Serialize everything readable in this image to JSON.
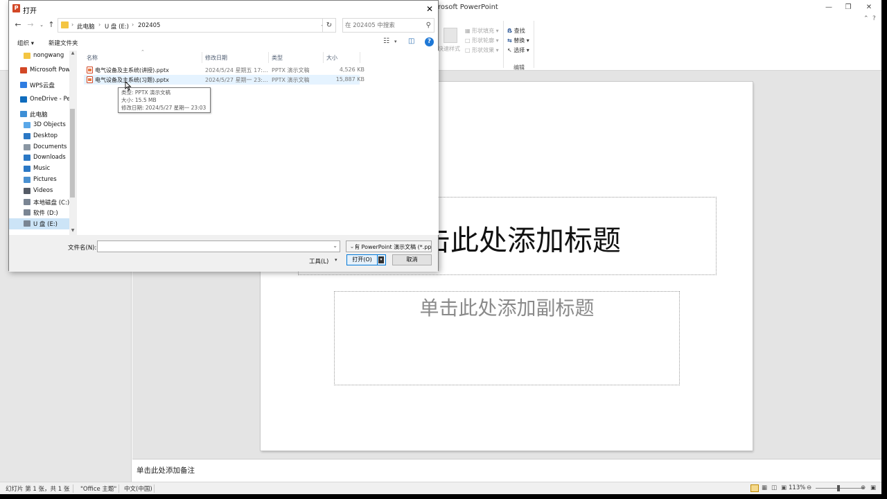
{
  "ppt": {
    "window_title": "rosoft PowerPoint",
    "ribbon": {
      "quick_styles": "快速样式",
      "shape_fill": "形状填充",
      "shape_outline": "形状轮廓",
      "shape_effects": "形状效果",
      "find": "查找",
      "replace": "替换",
      "select": "选择",
      "edit_group": "编辑"
    },
    "slide": {
      "title_placeholder": "单击此处添加标题",
      "subtitle_placeholder": "单击此处添加副标题"
    },
    "notes_placeholder": "单击此处添加备注",
    "status": {
      "slide_info": "幻灯片 第 1 张，共 1 张",
      "theme": "\"Office 主题\"",
      "language": "中文(中国)",
      "zoom": "113%"
    }
  },
  "dialog": {
    "title": "打开",
    "app_icon_letter": "P",
    "breadcrumb": [
      "此电脑",
      "U 盘 (E:)",
      "202405"
    ],
    "search_placeholder": "在 202405 中搜索",
    "toolbar": {
      "organize": "组织 ▾",
      "new_folder": "新建文件夹"
    },
    "nav_items": [
      {
        "label": "nongwang",
        "icon": "folder-icon",
        "color": "#f4c542",
        "indent": 1
      },
      {
        "label": "Microsoft Powe",
        "icon": "powerpoint-icon",
        "color": "#d24726",
        "indent": 0
      },
      {
        "label": "WPS云盘",
        "icon": "cloud-icon",
        "color": "#2f7de1",
        "indent": 0
      },
      {
        "label": "OneDrive - Per",
        "icon": "onedrive-icon",
        "color": "#0f6cbd",
        "indent": 0
      },
      {
        "label": "此电脑",
        "icon": "computer-icon",
        "color": "#3d8fd6",
        "indent": 0
      },
      {
        "label": "3D Objects",
        "icon": "3d-objects-icon",
        "color": "#5aa7e8",
        "indent": 1
      },
      {
        "label": "Desktop",
        "icon": "desktop-icon",
        "color": "#2b78c5",
        "indent": 1
      },
      {
        "label": "Documents",
        "icon": "documents-icon",
        "color": "#8a96a3",
        "indent": 1
      },
      {
        "label": "Downloads",
        "icon": "downloads-icon",
        "color": "#2b78c5",
        "indent": 1
      },
      {
        "label": "Music",
        "icon": "music-icon",
        "color": "#2b78c5",
        "indent": 1
      },
      {
        "label": "Pictures",
        "icon": "pictures-icon",
        "color": "#4a90d0",
        "indent": 1
      },
      {
        "label": "Videos",
        "icon": "videos-icon",
        "color": "#555b66",
        "indent": 1
      },
      {
        "label": "本地磁盘 (C:)",
        "icon": "drive-icon",
        "color": "#7a8593",
        "indent": 1
      },
      {
        "label": "软件 (D:)",
        "icon": "drive-icon",
        "color": "#7a8593",
        "indent": 1
      },
      {
        "label": "U 盘 (E:)",
        "icon": "usb-drive-icon",
        "color": "#7a8593",
        "indent": 1,
        "selected": true
      }
    ],
    "columns": [
      "名称",
      "修改日期",
      "类型",
      "大小"
    ],
    "files": [
      {
        "name": "电气设备及主系统(讲授).pptx",
        "date": "2024/5/24 星期五 17:...",
        "type": "PPTX 演示文稿",
        "size": "4,526 KB",
        "hover": false
      },
      {
        "name": "电气设备及主系统(习题).pptx",
        "date": "2024/5/27 星期一 23:...",
        "type": "PPTX 演示文稿",
        "size": "15,887 KB",
        "hover": true
      }
    ],
    "tooltip": {
      "type": "类型: PPTX 演示文稿",
      "size": "大小: 15.5 MB",
      "modified": "修改日期: 2024/5/27 星期一 23:03"
    },
    "filename_label": "文件名(N):",
    "filename_value": "",
    "filetype": "所有 PowerPoint 演示文稿 (*.pptx",
    "tools": "工具(L)",
    "open": "打开(O)",
    "cancel": "取消"
  }
}
